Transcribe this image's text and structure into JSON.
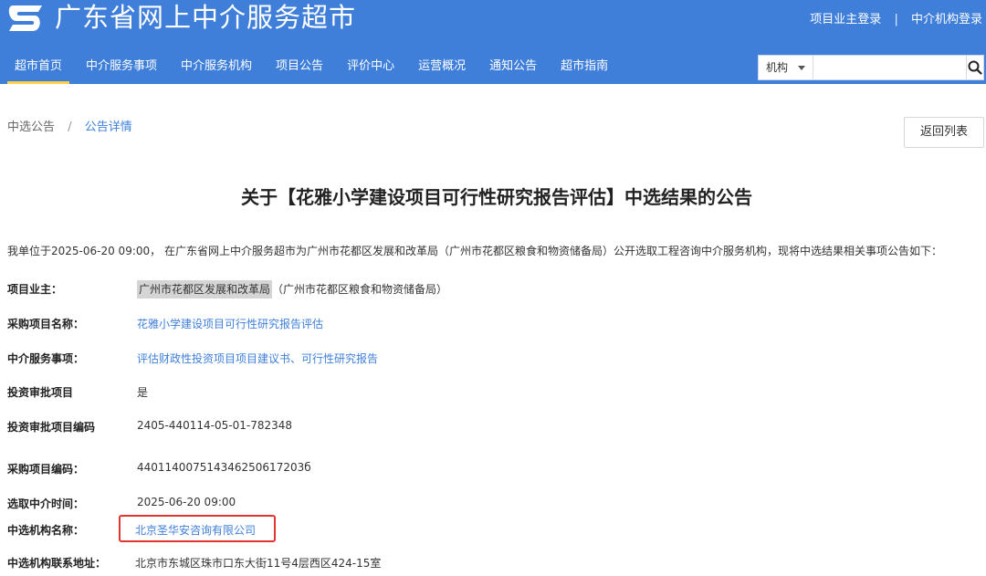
{
  "header": {
    "site_title": "广东省网上中介服务超市",
    "logo_icon": "s-logo-icon",
    "login_owner": "项目业主登录",
    "login_separator": "|",
    "login_agency": "中介机构登录"
  },
  "nav": {
    "items": [
      {
        "label": "超市首页",
        "active": true
      },
      {
        "label": "中介服务事项"
      },
      {
        "label": "中介服务机构"
      },
      {
        "label": "项目公告"
      },
      {
        "label": "评价中心"
      },
      {
        "label": "运营概况"
      },
      {
        "label": "通知公告"
      },
      {
        "label": "超市指南"
      }
    ]
  },
  "search": {
    "selected_option": "机构",
    "value": "",
    "placeholder": ""
  },
  "breadcrumb": {
    "parent": "中选公告",
    "separator": "/",
    "current": "公告详情"
  },
  "back_button": "返回列表",
  "notice": {
    "title": "关于【花雅小学建设项目可行性研究报告评估】中选结果的公告",
    "intro": "我单位于2025-06-20 09:00， 在广东省网上中介服务超市为广州市花都区发展和改革局（广州市花都区粮食和物资储备局）公开选取工程咨询中介服务机构，现将中选结果相关事项公告如下：",
    "fields": {
      "owner": {
        "label": "项目业主：",
        "value_highlight": "广州市花都区发展和改革局",
        "value_rest": "（广州市花都区粮食和物资储备局）"
      },
      "project_name": {
        "label": "采购项目名称：",
        "value": "花雅小学建设项目可行性研究报告评估"
      },
      "service_item": {
        "label": "中介服务事项：",
        "value": "评估财政性投资项目项目建议书、可行性研究报告"
      },
      "approval": {
        "label": "投资审批项目",
        "value": "是"
      },
      "approval_code": {
        "label": "投资审批项目编码",
        "value": "2405-440114-05-01-782348"
      },
      "purchase_code": {
        "label": "采购项目编码：",
        "value": "440114007514346250617203б"
      },
      "select_time": {
        "label": "选取中介时间：",
        "value": "2025-06-20 09:00"
      },
      "agency_name": {
        "label": "中选机构名称：",
        "value": "北京圣华安咨询有限公司"
      },
      "agency_address": {
        "label": "中选机构联系地址：",
        "value": "北京市东城区珠市口东大街11号4层西区424-15室"
      }
    }
  },
  "colors": {
    "header_bg": "#3f7fd9",
    "link": "#3f7fd9",
    "nav_active_underline": "#ffd24a",
    "highlight_box": "#e0342f"
  }
}
